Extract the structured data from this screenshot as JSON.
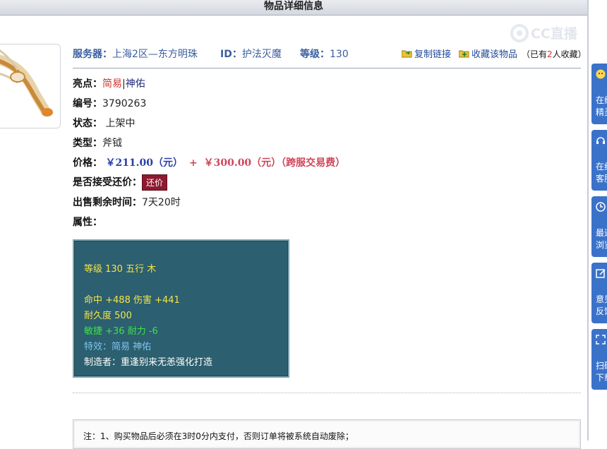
{
  "title": "物品详细信息",
  "watermark": "CC直播",
  "server": {
    "label": "服务器：",
    "value": "上海2区—东方明珠"
  },
  "seller_id": {
    "label": "ID：",
    "value": "护法灭魔"
  },
  "level": {
    "label": "等级：",
    "value": "130"
  },
  "actions": {
    "copy_link": "复制链接",
    "favorite": "收藏该物品",
    "favorite_count_prefix": "（已有",
    "favorite_count": "2",
    "favorite_count_suffix": "人收藏）"
  },
  "details": {
    "highlight_label": "亮点：",
    "highlight_1": "简易",
    "highlight_sep": "|",
    "highlight_2": "神佑",
    "serial_label": "编号：",
    "serial_value": "3790263",
    "status_label": "状态：",
    "status_value": "上架中",
    "type_label": "类型：",
    "type_value": "斧钺",
    "price_label": "价格：",
    "price_value": "￥211.00（元）",
    "price_plus": "+",
    "fee_value": "￥300.00（元）（跨服交易费）",
    "haggle_label": "是否接受还价：",
    "haggle_button": "还价",
    "remaining_label": "出售剩余时间：",
    "remaining_value": "7天20时",
    "attributes_label": "属性："
  },
  "attributes": {
    "line1": "等级 130 五行 木",
    "line2": "命中 +488 伤害 +441",
    "line3": "耐久度 500",
    "line4": "敏捷 +36 耐力 -6",
    "line5": "特效：简易 神佑",
    "line6": "制造者：重逢别来无恙强化打造"
  },
  "notice": "注：1、购买物品后必须在3时0分内支付，否则订单将被系统自动废除；",
  "side_tools": [
    {
      "label": "在线精灵"
    },
    {
      "label": "在线客服"
    },
    {
      "label": "最近浏览"
    },
    {
      "label": "意见反馈"
    },
    {
      "label": "扫码下载"
    }
  ],
  "colors": {
    "accent_blue": "#3a5e9f",
    "price_blue": "#2b3ea8",
    "fee_red": "#d0465a",
    "attr_bg": "#2c5f6f",
    "haggle_btn": "#8d1a2f",
    "side_bar": "#3b72c9"
  }
}
